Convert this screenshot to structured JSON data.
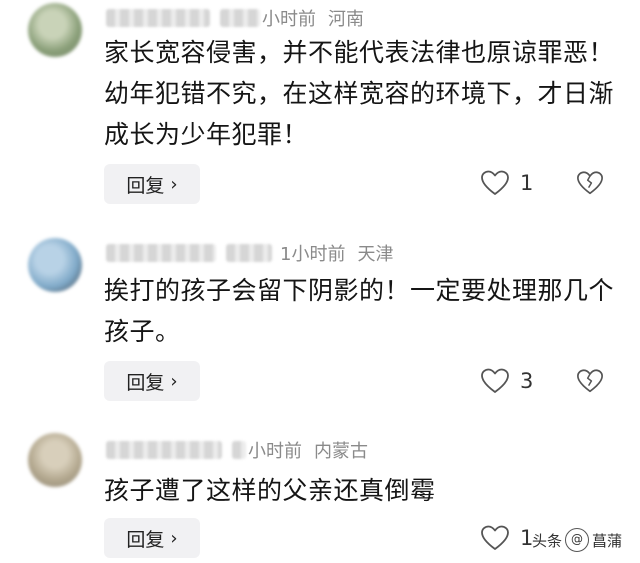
{
  "comments": [
    {
      "time": "小时前",
      "location": "河南",
      "text": "家长宽容侵害，并不能代表法律也原谅罪恶！幼年犯错不究，在这样宽容的环境下，才日渐成长为少年犯罪！",
      "reply_label": "回复",
      "likes": "1",
      "avatar_color": "#8ba07a"
    },
    {
      "time": "1小时前",
      "location": "天津",
      "text": "挨打的孩子会留下阴影的！一定要处理那几个孩子。",
      "reply_label": "回复",
      "likes": "3",
      "avatar_color": "#7fa9c8"
    },
    {
      "time": "小时前",
      "location": "内蒙古",
      "text": "孩子遭了这样的父亲还真倒霉",
      "reply_label": "回复",
      "likes": "1",
      "avatar_color": "#b3a88f"
    }
  ],
  "watermark": {
    "prefix": "头条",
    "handle": "菖蒲"
  }
}
